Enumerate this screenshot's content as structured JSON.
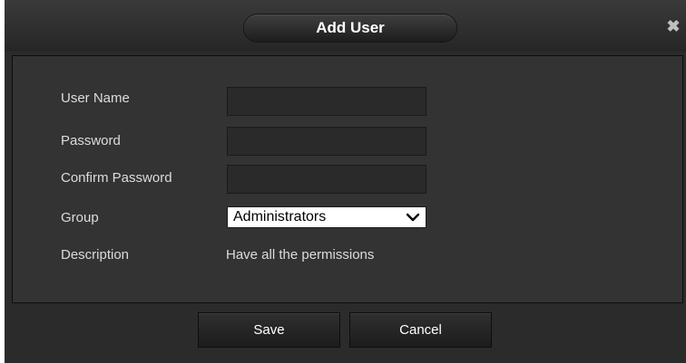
{
  "dialog": {
    "title": "Add User",
    "close_icon": "close-icon"
  },
  "form": {
    "username_label": "User Name",
    "username_value": "",
    "password_label": "Password",
    "password_value": "",
    "confirm_password_label": "Confirm Password",
    "confirm_password_value": "",
    "group_label": "Group",
    "group_selected": "Administrators",
    "group_icon": "chevron-down-icon",
    "description_label": "Description",
    "description_value": "Have all the permissions"
  },
  "footer": {
    "save_label": "Save",
    "cancel_label": "Cancel"
  },
  "colors": {
    "dialog_bg": "#2b2b2b",
    "content_bg": "#333333",
    "text": "#dcdcdc",
    "title_text": "#ffffff"
  }
}
